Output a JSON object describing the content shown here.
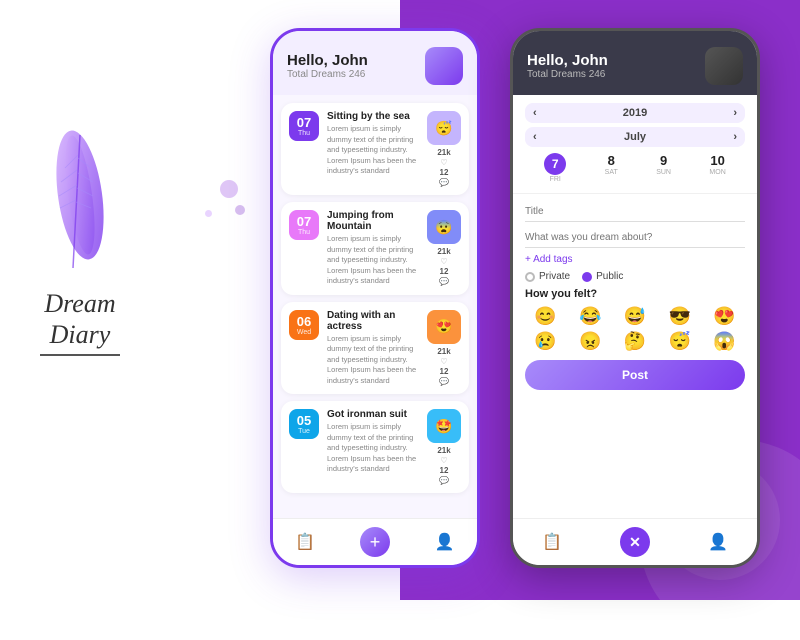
{
  "brand": {
    "title_line1": "Dream",
    "title_line2": "Diary"
  },
  "left_phone": {
    "header": {
      "greeting": "Hello, John",
      "total_dreams_label": "Total Dreams",
      "total_dreams_count": "246"
    },
    "dreams": [
      {
        "day": "07",
        "dow": "Thu",
        "badge_class": "badge-purple",
        "title": "Sitting by the sea",
        "desc": "Lorem ipsum is simply dummy text of the printing and typesetting industry. Lorem Ipsum has been the industry's standard",
        "thumb_color": "#a78bfa",
        "stat": "21k",
        "stat2": "12"
      },
      {
        "day": "07",
        "dow": "Thu",
        "badge_class": "badge-pink",
        "title": "Jumping from Mountain",
        "desc": "Lorem ipsum is simply dummy text of the printing and typesetting industry. Lorem Ipsum has been the industry's standard",
        "thumb_color": "#6366f1",
        "stat": "21k",
        "stat2": "12"
      },
      {
        "day": "06",
        "dow": "Wed",
        "badge_class": "badge-orange",
        "title": "Dating with an actress",
        "desc": "Lorem ipsum is simply dummy text of the printing and typesetting industry. Lorem Ipsum has been the industry's standard",
        "thumb_color": "#f97316",
        "stat": "21k",
        "stat2": "12"
      },
      {
        "day": "05",
        "dow": "Tue",
        "badge_class": "badge-teal",
        "title": "Got ironman suit",
        "desc": "Lorem ipsum is simply dummy text of the printing and typesetting industry. Lorem Ipsum has been the industry's standard",
        "thumb_color": "#0ea5e9",
        "stat": "21k",
        "stat2": "12"
      }
    ],
    "nav": {
      "tab1": "📋",
      "tab2": "+",
      "tab3": "👤"
    }
  },
  "right_phone": {
    "header": {
      "greeting": "Hello, John",
      "total_dreams_label": "Total Dreams",
      "total_dreams_count": "246"
    },
    "calendar": {
      "year": "2019",
      "month": "July",
      "days": [
        {
          "num": "7",
          "lbl": "FRI",
          "active": true
        },
        {
          "num": "8",
          "lbl": "SAT",
          "active": false
        },
        {
          "num": "9",
          "lbl": "SUN",
          "active": false
        },
        {
          "num": "10",
          "lbl": "MON",
          "active": false
        }
      ]
    },
    "form": {
      "title_placeholder": "Title",
      "desc_placeholder": "What was you dream about?",
      "tags_label": "+ Add tags",
      "privacy_options": [
        "Private",
        "Public"
      ],
      "felt_label": "How you felt?",
      "emojis": [
        "😊",
        "😂",
        "😅",
        "😎",
        "😍",
        "😢",
        "😠",
        "🤔",
        "😴",
        "😱"
      ],
      "post_label": "Post"
    }
  }
}
